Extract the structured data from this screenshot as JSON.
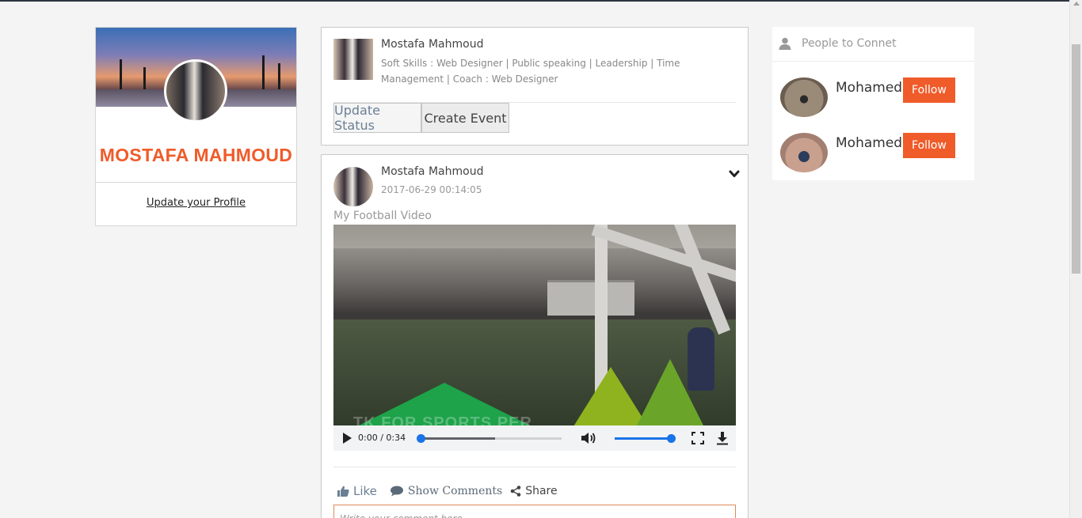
{
  "profile": {
    "name": "MOSTAFA MAHMOUD",
    "update_link": "Update your Profile"
  },
  "composer": {
    "author": "Mostafa Mahmoud",
    "headline": "Soft Skills : Web Designer | Public speaking | Leadership | Time Management | Coach : Web Designer",
    "update_status_label": "Update Status",
    "create_event_label": "Create Event"
  },
  "post": {
    "author": "Mostafa Mahmoud",
    "date": "2017-06-29 00:14:05",
    "caption": "My Football Video",
    "video": {
      "watermark": "TK FOR SPORTS PER",
      "time": "0:00 / 0:34",
      "buffered_fraction": 0.53,
      "played_fraction": 0.0,
      "volume_fraction": 1.0
    },
    "actions": {
      "like": "Like",
      "comments": "Show Comments",
      "share": "Share"
    },
    "comment_placeholder": "Write your comment here..."
  },
  "people": {
    "title": "People to Connet",
    "items": [
      {
        "name": "Mohamed",
        "follow": "Follow"
      },
      {
        "name": "Mohamed",
        "follow": "Follow"
      }
    ]
  },
  "colors": {
    "accent": "#f05b2a",
    "link_blue": "#6b7f94",
    "background": "#f4f4f4"
  },
  "icons": [
    "thumbs-up-icon",
    "comment-icon",
    "share-icon",
    "user-icon",
    "chevron-down-icon",
    "play-icon",
    "volume-icon",
    "fullscreen-icon",
    "download-icon"
  ]
}
